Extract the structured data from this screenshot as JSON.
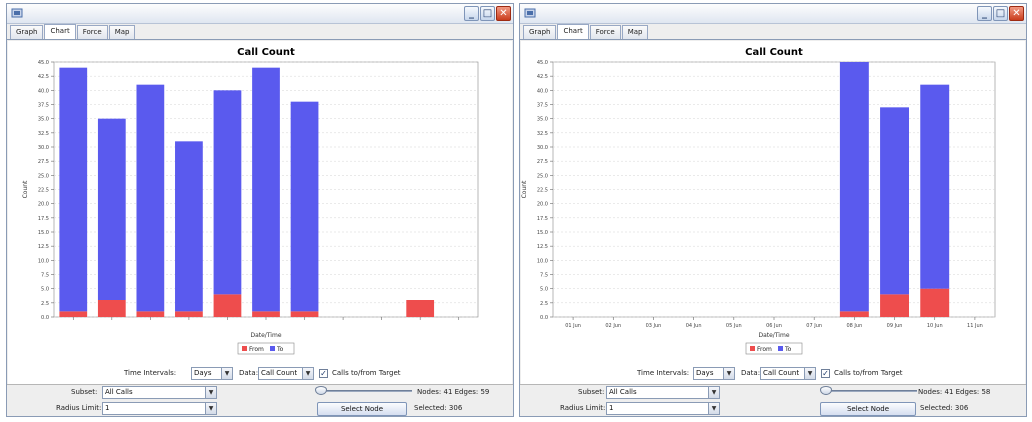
{
  "left_window": {
    "tabs": [
      "Graph",
      "Chart",
      "Force",
      "Map"
    ],
    "active_tab": 1,
    "controls": {
      "time_intervals_label": "Time Intervals:",
      "time_intervals_value": "Days",
      "data_label": "Data:",
      "data_value": "Call Count",
      "checkbox_label": "Calls to/from Target",
      "checkbox_checked": true
    },
    "status": {
      "subset_label": "Subset:",
      "subset_value": "All Calls",
      "radius_label": "Radius Limit:",
      "radius_value": "1",
      "slider_value": 0,
      "nodes_edges_text": "Nodes: 41 Edges: 59",
      "select_node_button": "Select Node",
      "selected_text": "Selected: 306"
    }
  },
  "right_window": {
    "tabs": [
      "Graph",
      "Chart",
      "Force",
      "Map"
    ],
    "active_tab": 1,
    "controls": {
      "time_intervals_label": "Time Intervals:",
      "time_intervals_value": "Days",
      "data_label": "Data:",
      "data_value": "Call Count",
      "checkbox_label": "Calls to/from Target",
      "checkbox_checked": true
    },
    "status": {
      "subset_label": "Subset:",
      "subset_value": "All Calls",
      "radius_label": "Radius Limit:",
      "radius_value": "1",
      "slider_value": 0,
      "nodes_edges_text": "Nodes: 41 Edges: 58",
      "select_node_button": "Select Node",
      "selected_text": "Selected: 306"
    }
  },
  "colors": {
    "to_series": "#5a5aee",
    "from_series": "#ee4d4d",
    "close_button": "#d2452a"
  },
  "chart_data": [
    {
      "type": "bar",
      "stacked": true,
      "title": "Call Count",
      "xlabel": "Date/Time",
      "ylabel": "Count",
      "ylim": [
        0,
        45
      ],
      "y_ticks": [
        "0.0",
        "2.5",
        "5.0",
        "7.5",
        "10.0",
        "12.5",
        "15.0",
        "17.5",
        "20.0",
        "22.5",
        "25.0",
        "27.5",
        "30.0",
        "32.5",
        "35.0",
        "37.5",
        "40.0",
        "42.5",
        "45.0"
      ],
      "categories": [
        "",
        "",
        "",
        "",
        "",
        "",
        "",
        "",
        "",
        "",
        ""
      ],
      "series": [
        {
          "name": "From",
          "values": [
            1,
            3,
            1,
            1,
            4,
            1,
            1,
            0,
            0,
            3,
            0
          ]
        },
        {
          "name": "To",
          "values": [
            43,
            32,
            40,
            30,
            36,
            43,
            37,
            0,
            0,
            0,
            0
          ]
        }
      ],
      "legend": "bottom",
      "grid": true
    },
    {
      "type": "bar",
      "stacked": true,
      "title": "Call Count",
      "xlabel": "Date/Time",
      "ylabel": "Count",
      "ylim": [
        0,
        45
      ],
      "y_ticks": [
        "0.0",
        "2.5",
        "5.0",
        "7.5",
        "10.0",
        "12.5",
        "15.0",
        "17.5",
        "20.0",
        "22.5",
        "25.0",
        "27.5",
        "30.0",
        "32.5",
        "35.0",
        "37.5",
        "40.0",
        "42.5",
        "45.0"
      ],
      "categories": [
        "01 Jun",
        "02 Jun",
        "03 Jun",
        "04 Jun",
        "05 Jun",
        "06 Jun",
        "07 Jun",
        "08 Jun",
        "09 Jun",
        "10 Jun",
        "11 Jun"
      ],
      "series": [
        {
          "name": "From",
          "values": [
            0,
            0,
            0,
            0,
            0,
            0,
            0,
            1,
            4,
            5,
            0
          ]
        },
        {
          "name": "To",
          "values": [
            0,
            0,
            0,
            0,
            0,
            0,
            0,
            44,
            33,
            36,
            0
          ]
        }
      ],
      "legend": "bottom",
      "grid": true
    }
  ]
}
